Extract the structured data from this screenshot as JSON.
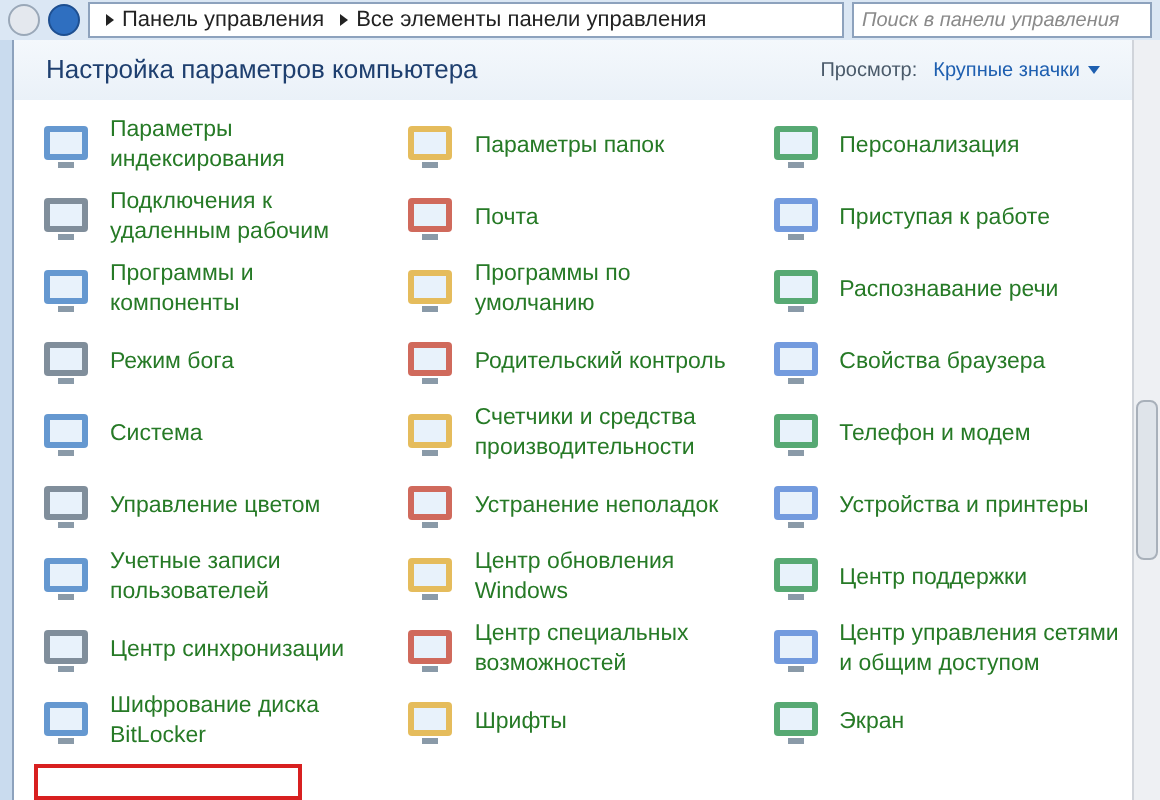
{
  "address_bar": {
    "breadcrumbs": [
      "Панель управления",
      "Все элементы панели управления"
    ],
    "search": {
      "placeholder": "Поиск в панели управления"
    }
  },
  "header": {
    "title": "Настройка параметров компьютера",
    "view_label": "Просмотр:",
    "view_value": "Крупные значки"
  },
  "items": [
    {
      "lines": [
        "Параметры",
        "индексирования"
      ]
    },
    {
      "lines": [
        "Параметры папок"
      ]
    },
    {
      "lines": [
        "Персонализация"
      ]
    },
    {
      "lines": [
        "Подключения к",
        "удаленным рабочим"
      ]
    },
    {
      "lines": [
        "Почта"
      ]
    },
    {
      "lines": [
        "Приступая к работе"
      ]
    },
    {
      "lines": [
        "Программы и",
        "компоненты"
      ]
    },
    {
      "lines": [
        "Программы по",
        "умолчанию"
      ]
    },
    {
      "lines": [
        "Распознавание речи"
      ]
    },
    {
      "lines": [
        "Режим бога"
      ]
    },
    {
      "lines": [
        "Родительский контроль"
      ]
    },
    {
      "lines": [
        "Свойства браузера"
      ]
    },
    {
      "lines": [
        "Система"
      ]
    },
    {
      "lines": [
        "Счетчики и средства",
        "производительности"
      ]
    },
    {
      "lines": [
        "Телефон и модем"
      ]
    },
    {
      "lines": [
        "Управление цветом"
      ]
    },
    {
      "lines": [
        "Устранение неполадок"
      ]
    },
    {
      "lines": [
        "Устройства и принтеры"
      ]
    },
    {
      "lines": [
        "Учетные записи",
        "пользователей"
      ]
    },
    {
      "lines": [
        "Центр обновления",
        "Windows"
      ]
    },
    {
      "lines": [
        "Центр поддержки"
      ]
    },
    {
      "lines": [
        "Центр синхронизации"
      ]
    },
    {
      "lines": [
        "Центр специальных",
        "возможностей"
      ]
    },
    {
      "lines": [
        "Центр управления сетями",
        "и общим доступом"
      ]
    },
    {
      "lines": [
        "Шифрование диска",
        "BitLocker"
      ]
    },
    {
      "lines": [
        "Шрифты"
      ]
    },
    {
      "lines": [
        "Экран"
      ]
    }
  ]
}
